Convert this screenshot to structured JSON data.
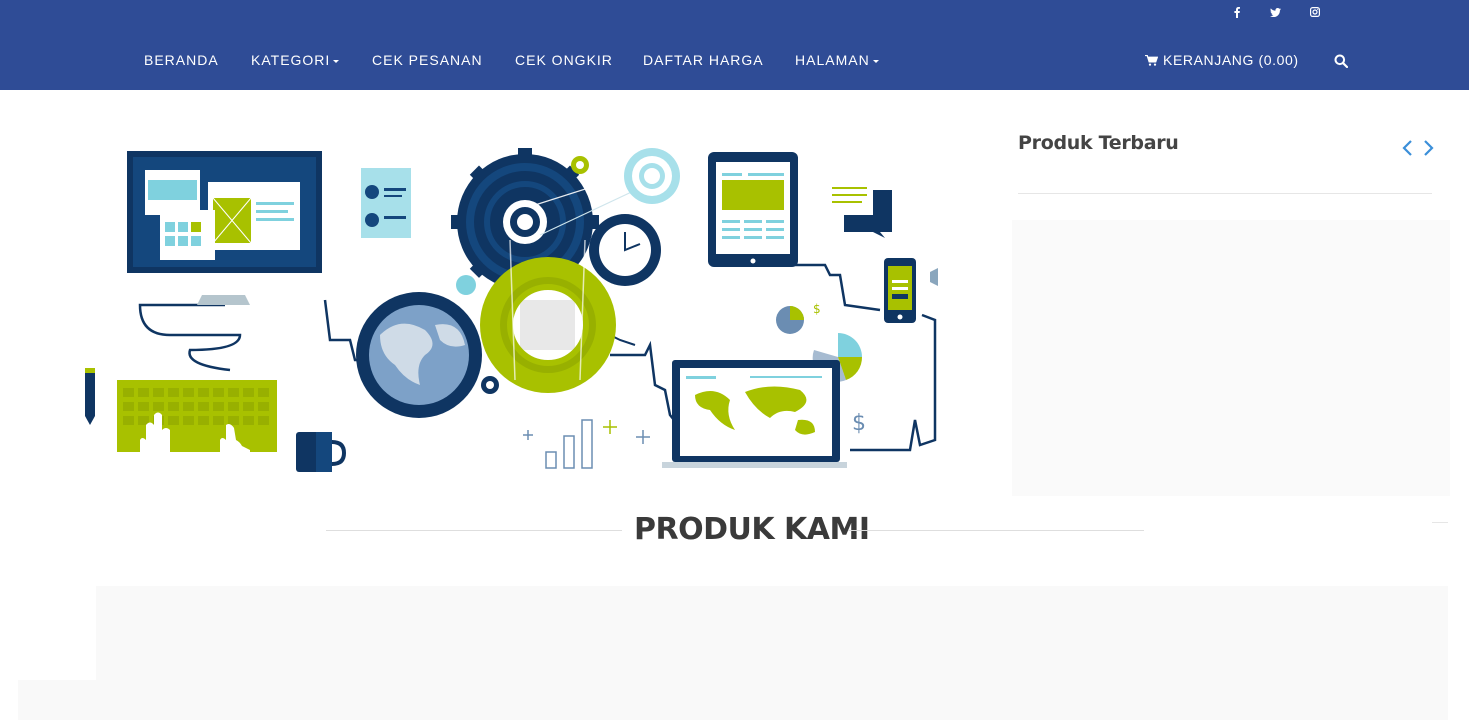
{
  "header": {
    "social": [
      {
        "icon": "facebook-icon"
      },
      {
        "icon": "twitter-icon"
      },
      {
        "icon": "instagram-icon"
      }
    ],
    "nav": [
      {
        "label": "BERANDA",
        "dropdown": false
      },
      {
        "label": "KATEGORI",
        "dropdown": true
      },
      {
        "label": "CEK PESANAN",
        "dropdown": false
      },
      {
        "label": "CEK ONGKIR",
        "dropdown": false
      },
      {
        "label": "DAFTAR HARGA",
        "dropdown": false
      },
      {
        "label": "HALAMAN",
        "dropdown": true
      }
    ],
    "cart_label": "KERANJANG (0.00)",
    "search_icon": "search-icon"
  },
  "sidebar": {
    "title": "Produk Terbaru",
    "prev_icon": "chevron-left-icon",
    "next_icon": "chevron-right-icon"
  },
  "main": {
    "section_title": "PRODUK KAMI"
  },
  "colors": {
    "header_bg": "#2f4c96",
    "navy": "#0f3562",
    "lime": "#a8c100",
    "teal": "#7fd1de",
    "arrow": "#3b8fd9"
  }
}
